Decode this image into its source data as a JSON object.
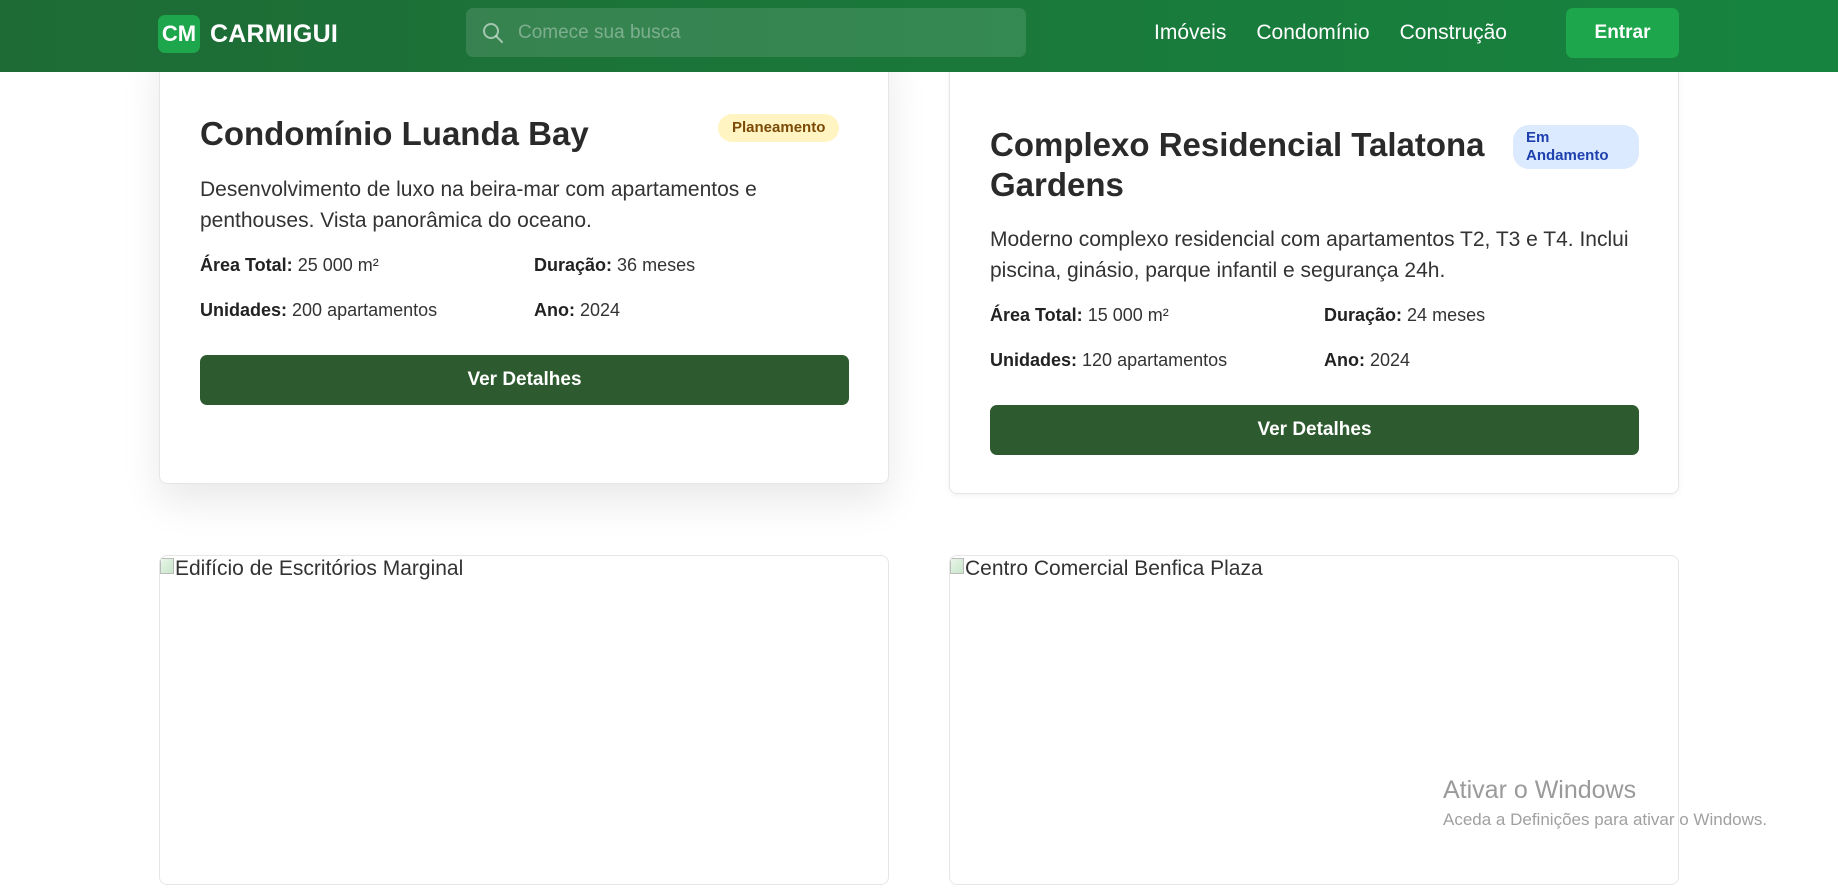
{
  "navbar": {
    "brand_mark": "CM",
    "brand_name": "CARMIGUI",
    "search_placeholder": "Comece sua busca",
    "links": [
      "Imóveis",
      "Condomínio",
      "Construção"
    ],
    "login_label": "Entrar"
  },
  "projects": [
    {
      "title": "Condomínio Luanda Bay",
      "status": "Planeamento",
      "description": "Desenvolvimento de luxo na beira-mar com apartamentos e penthouses. Vista panorâmica do oceano.",
      "specs": {
        "area_label": "Área Total:",
        "area_value": "25 000 m²",
        "duration_label": "Duração:",
        "duration_value": "36 meses",
        "units_label": "Unidades:",
        "units_value": "200 apartamentos",
        "year_label": "Ano:",
        "year_value": "2024"
      },
      "button_label": "Ver Detalhes"
    },
    {
      "title": "Complexo Residencial Talatona Gardens",
      "status": "Em Andamento",
      "description": "Moderno complexo residencial com apartamentos T2, T3 e T4. Inclui piscina, ginásio, parque infantil e segurança 24h.",
      "specs": {
        "area_label": "Área Total:",
        "area_value": "15 000 m²",
        "duration_label": "Duração:",
        "duration_value": "24 meses",
        "units_label": "Unidades:",
        "units_value": "120 apartamentos",
        "year_label": "Ano:",
        "year_value": "2024"
      },
      "button_label": "Ver Detalhes"
    }
  ],
  "image_cards": [
    {
      "alt": "Edifício de Escritórios Marginal"
    },
    {
      "alt": "Centro Comercial Benfica Plaza"
    }
  ],
  "watermark": {
    "title": "Ativar o Windows",
    "subtitle": "Aceda a Definições para ativar o Windows."
  },
  "colors": {
    "nav_bg": "#1e6b35",
    "accent": "#1da64b",
    "button_dark": "#2d5a2e",
    "badge_planning_bg": "#fff4c2",
    "badge_progress_bg": "#dbeafe"
  }
}
